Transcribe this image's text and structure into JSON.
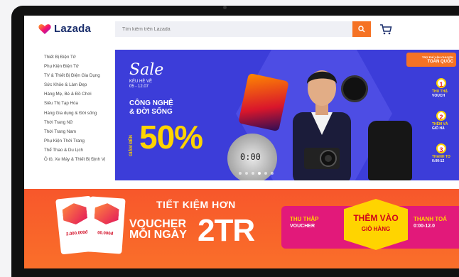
{
  "header": {
    "logo_text": "Lazada",
    "search_placeholder": "Tìm kiếm trên Lazada",
    "brand_color": "#f57224"
  },
  "sidebar": {
    "items": [
      "Thiết Bị Điện Tử",
      "Phụ Kiện Điện Tử",
      "TV & Thiết Bị Điện Gia Dụng",
      "Sức Khỏe & Làm Đẹp",
      "Hàng Mẹ, Bé & Đồ Chơi",
      "Siêu Thị Tạp Hóa",
      "Hàng Gia dụng & Đời sống",
      "Thời Trang Nữ",
      "Thời Trang Nam",
      "Phụ Kiện Thời Trang",
      "Thể Thao & Du Lịch",
      "Ô tô, Xe Máy & Thiết Bị Định Vị"
    ]
  },
  "hero": {
    "sale": "Sale",
    "sale_sub_1": "KÉU HÈ VỀ",
    "sale_sub_2": "05 - 12.07",
    "headline_1": "CÔNG NGHỆ",
    "headline_2": "& ĐỜI SỐNG",
    "discount_prefix": "GIẢM ĐẾN",
    "discount": "50%",
    "speaker_time": "0:00",
    "corner_line_1": "TRỢ PHÍ VẬN CHUYỂN",
    "corner_line_2": "TOÀN QUỐC",
    "steps": [
      {
        "num": "1",
        "label": "THU THẬ",
        "sub": "VOUCH"
      },
      {
        "num": "2",
        "label": "THÊM VÀ",
        "sub": "GIỎ HÀ"
      },
      {
        "num": "3",
        "label": "THANH TO",
        "sub": "0:00-12"
      }
    ],
    "active_slide": 3
  },
  "promo": {
    "card_1_amount": "2.000.000đ",
    "card_2_amount": "00.000đ",
    "headline": "TIẾT KIỆM HƠN",
    "voucher_line_1": "VOUCHER",
    "voucher_line_2": "MỖI NGÀY",
    "amount": "2TR",
    "step_1": "THU THẬP",
    "step_1_sub": "VOUCHER",
    "step_2": "THÊM VÀO",
    "step_2_sub": "GIỎ HÀNG",
    "step_3": "THANH TOÁ",
    "step_3_sub": "0:00-12.0"
  }
}
